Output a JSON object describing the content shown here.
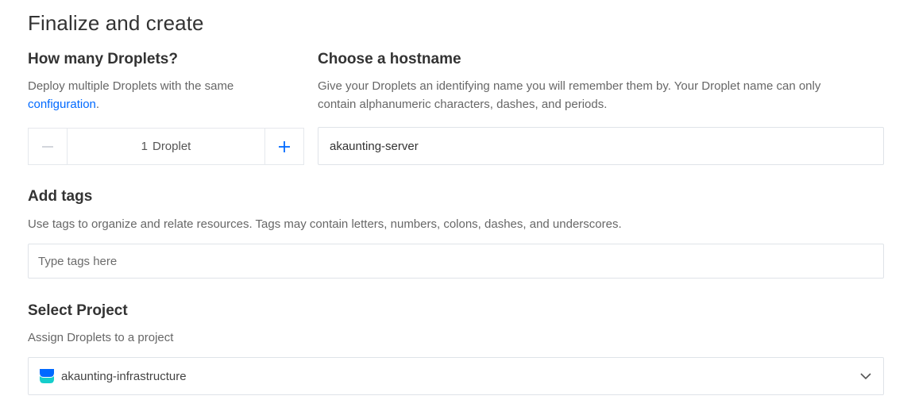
{
  "title": "Finalize and create",
  "droplets": {
    "heading": "How many Droplets?",
    "desc_text": "Deploy multiple Droplets with the same",
    "desc_link": "configuration",
    "desc_end": ".",
    "count": "1",
    "unit": "Droplet",
    "minus_icon": "minus-icon",
    "plus_icon": "plus-icon"
  },
  "hostname": {
    "heading": "Choose a hostname",
    "desc_line1": "Give your Droplets an identifying name you will remember them by. Your Droplet name can only",
    "desc_line2": "contain alphanumeric characters, dashes, and periods.",
    "value": "akaunting-server"
  },
  "tags": {
    "heading": "Add tags",
    "desc": "Use tags to organize and relate resources. Tags may contain letters, numbers, colons, dashes, and underscores.",
    "placeholder": "Type tags here"
  },
  "project": {
    "heading": "Select Project",
    "desc": "Assign Droplets to a project",
    "selected": "akaunting-infrastructure",
    "icon": "project-icon",
    "icon_colors": [
      "#0069ff",
      "#15cdcb"
    ]
  },
  "colors": {
    "accent": "#0069ff"
  }
}
